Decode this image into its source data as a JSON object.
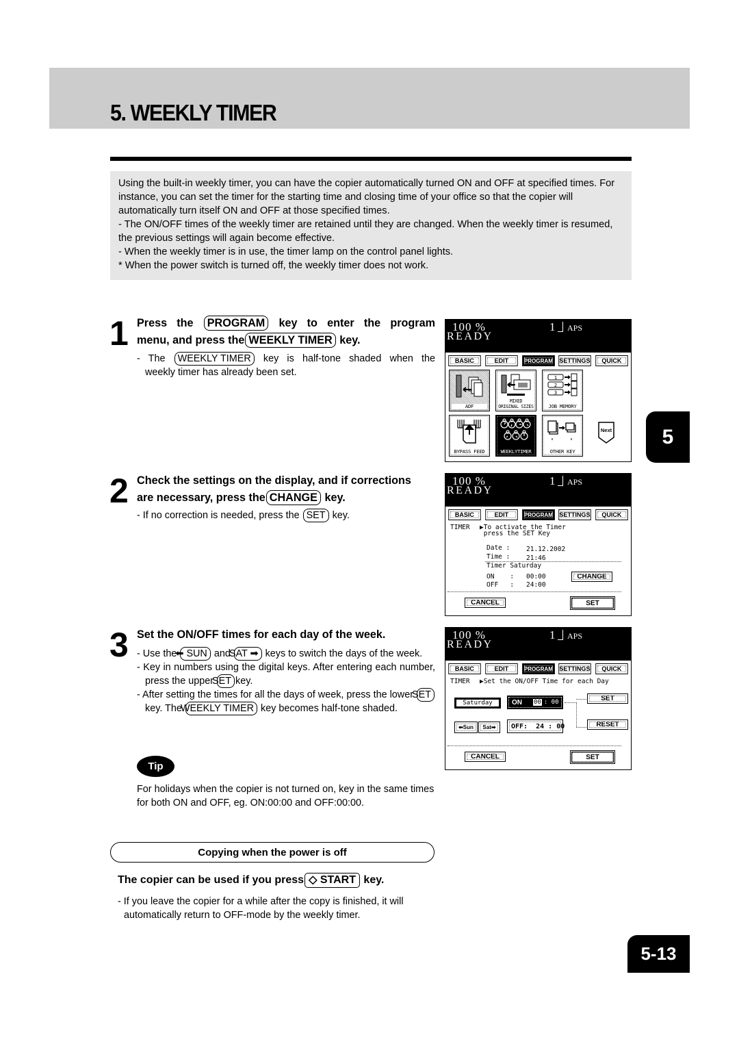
{
  "page": {
    "title": "5. WEEKLY TIMER",
    "side_tab": "5",
    "page_number": "5-13"
  },
  "intro": {
    "paragraph": "Using the built-in weekly timer, you can have the copier automatically turned ON and OFF at specified times.  For instance, you can set the timer for the starting time and closing time of your office so that the copier will automatically turn itself ON and OFF at those specified times.",
    "note1": "- The ON/OFF times of the weekly timer are retained until they are changed. When the weekly timer is resumed, the previous settings will again become effective.",
    "note2": "- When the weekly timer is in use, the timer lamp on the control panel lights.",
    "note3": "* When the power switch is turned off, the weekly timer does not work."
  },
  "step1": {
    "number": "1",
    "head_a": "Press the",
    "key_program": "PROGRAM",
    "head_b": "key to enter the program",
    "head_c": "menu, and press the",
    "key_weekly": "WEEKLY TIMER",
    "head_d": "key.",
    "body_a": "- The",
    "body_key": "WEEKLY TIMER",
    "body_b": "key is half-tone shaded when the",
    "body_c": "weekly timer has already been set."
  },
  "step2": {
    "number": "2",
    "head_a": "Check the settings on the display,  and if corrections",
    "head_b": "are necessary,  press the",
    "key_change": "CHANGE",
    "head_c": "key.",
    "body_a": "- If no correction is needed, press the",
    "key_set": "SET",
    "body_b": "key."
  },
  "step3": {
    "number": "3",
    "head": "Set the ON/OFF times for each day of the week.",
    "b1_a": "- Use the",
    "key_sun": "⬅ SUN",
    "b1_b": "and",
    "key_sat": "SAT ➡",
    "b1_c": "keys to switch the days of the week.",
    "b2_a": "- Key in numbers using the digital keys.  After entering each number, press the upper",
    "key_set_upper": "SET",
    "b2_b": "key.",
    "b3_a": "- After setting the times for all the days of week, press the lower",
    "key_set_lower": "SET",
    "b3_b": "key.  The",
    "key_weekly": "WEEKLY TIMER",
    "b3_c": "key becomes half-tone shaded."
  },
  "tip": {
    "badge": "Tip",
    "text": "For holidays when the copier is not turned on, key in the same times for both ON and OFF, eg. ON:00:00 and OFF:00:00."
  },
  "copying_off": {
    "section_title": "Copying when the power is off",
    "head_a": "The copier can be used if you press",
    "key_start": "◇ START",
    "head_b": "key.",
    "body": "- If you leave the copier for a while after the copy is finished, it will automatically return to  OFF-mode  by the weekly timer."
  },
  "lcd_common": {
    "zoom": "100  %",
    "copies": "1",
    "paper": "APS",
    "status": "READY",
    "tabs": [
      "BASIC",
      "EDIT",
      "PROGRAM",
      "SETTINGS",
      "QUICK"
    ],
    "active_tab": "PROGRAM"
  },
  "screen1": {
    "tiles": [
      {
        "label": "ADF",
        "icon": "adf-icon",
        "state": "shaded"
      },
      {
        "label": "MIXED\nORIGINAL SIZES",
        "icon": "mixed-sizes-icon",
        "state": "normal"
      },
      {
        "label": "JOB MEMORY",
        "icon": "job-memory-icon",
        "state": "normal"
      },
      {
        "label": "BYPASS FEED",
        "icon": "bypass-feed-icon",
        "state": "normal"
      },
      {
        "label": "WEEKLYTIMER",
        "icon": "weekly-timer-icon",
        "state": "selected"
      },
      {
        "label": "OTHER KEY",
        "icon": "other-key-icon",
        "state": "normal"
      }
    ],
    "next_label": "Next"
  },
  "screen2": {
    "timer_label": "TIMER",
    "message": "▶To activate the Timer\n press the SET Key",
    "date_label": "Date :",
    "date_value": "21.12.2002",
    "time_label": "Time :",
    "time_value": "21:46",
    "timer_day": "Timer Saturday",
    "on_label": "ON    :",
    "on_value": "00:00",
    "off_label": "OFF   :",
    "off_value": "24:00",
    "change_button": "CHANGE",
    "cancel_button": "CANCEL",
    "set_button": "SET"
  },
  "screen3": {
    "timer_label": "TIMER",
    "message": "▶Set the ON/OFF Time for each Day",
    "day": "Saturday",
    "on_label": "ON",
    "on_hour": "00",
    "on_min": ": 00",
    "off_text": "OFF:  24 : 00",
    "sun_button": "⬅Sun",
    "sat_button": "Sat➡",
    "set_button_upper": "SET",
    "reset_button": "RESET",
    "cancel_button": "CANCEL",
    "set_button_lower": "SET"
  }
}
